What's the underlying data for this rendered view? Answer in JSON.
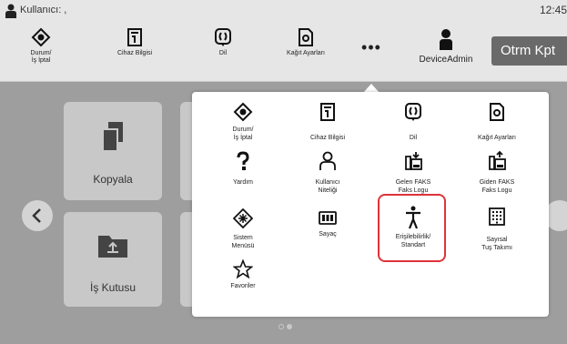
{
  "status_bar": {
    "user_label": "Kullanıcı:   ,",
    "clock": "12:45"
  },
  "toolbar": {
    "items": [
      {
        "label": "Durum/\nİş İptal",
        "icon": "status-diamond-icon"
      },
      {
        "label": "Cihaz Bilgisi",
        "icon": "device-info-icon"
      },
      {
        "label": "Dil",
        "icon": "language-icon"
      },
      {
        "label": "Kağıt Ayarları",
        "icon": "paper-settings-icon"
      }
    ],
    "more_label": "•••",
    "admin_label": "DeviceAdmin",
    "logout_label": "Otrm Kpt"
  },
  "home": {
    "tiles": [
      {
        "label": "Kopyala",
        "icon": "copy-icon"
      },
      {
        "label": "İş Kutusu",
        "icon": "job-box-icon"
      }
    ]
  },
  "popup": {
    "items": [
      {
        "label": "Durum/\nİş İptal",
        "icon": "status-diamond-icon"
      },
      {
        "label": "Cihaz Bilgisi",
        "icon": "device-info-icon"
      },
      {
        "label": "Dil",
        "icon": "language-icon"
      },
      {
        "label": "Kağıt Ayarları",
        "icon": "paper-settings-icon"
      },
      {
        "label": "Yardım",
        "icon": "help-icon"
      },
      {
        "label": "Kullanıcı\nNiteliği",
        "icon": "user-property-icon"
      },
      {
        "label": "Gelen FAKS\nFaks Logu",
        "icon": "incoming-fax-icon"
      },
      {
        "label": "Giden FAKS\nFaks Logu",
        "icon": "outgoing-fax-icon"
      },
      {
        "label": "Sistem\nMenüsü",
        "icon": "system-menu-icon"
      },
      {
        "label": "Sayaç",
        "icon": "counter-icon"
      },
      {
        "label": "Erişilebilirlik/\nStandart",
        "icon": "accessibility-icon"
      },
      {
        "label": "Sayısal\nTuş Takımı",
        "icon": "numeric-keypad-icon"
      },
      {
        "label": "Favoriler",
        "icon": "favorites-star-icon"
      }
    ],
    "highlighted_item": "Erişilebilirlik/\nStandart"
  },
  "colors": {
    "background_dim": "#9e9e9e",
    "toolbar_bg": "#e6e6e6",
    "highlight": "#e0323a",
    "logout_bg": "#6a6a6a"
  }
}
